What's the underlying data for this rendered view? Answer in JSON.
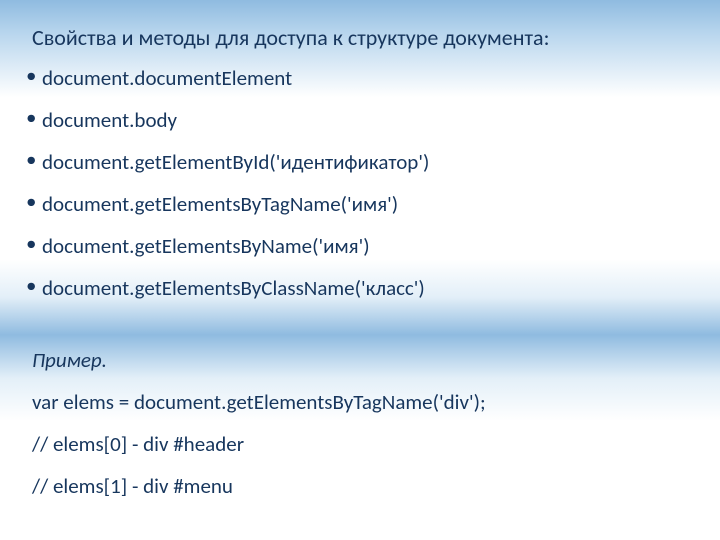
{
  "heading": "Свойства и методы для доступа к структуре документа:",
  "bullets": [
    "document.documentElement",
    "document.body",
    "document.getElementById('идентификатор')",
    "document.getElementsByTagName('имя')",
    "document.getElementsByName('имя')",
    "document.getElementsByClassName('класс')"
  ],
  "example": {
    "label": "Пример.",
    "lines": [
      "var elems = document.getElementsByTagName('div');",
      "//  elems[0] - div #header",
      "//  elems[1] - div #menu"
    ]
  }
}
